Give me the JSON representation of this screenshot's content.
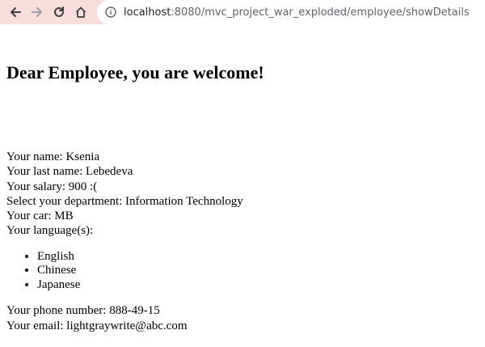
{
  "browser": {
    "url_host": "localhost",
    "url_rest": ":8080/mvc_project_war_exploded/employee/showDetails"
  },
  "page": {
    "heading": "Dear Employee, you are welcome!",
    "name_line": "Your name: Ksenia",
    "last_name_line": "Your last name: Lebedeva",
    "salary_line": "Your salary: 900 :(",
    "department_line": "Select your department: Information Technology",
    "car_line": "Your car: MB",
    "languages_label": "Your language(s):",
    "languages": [
      "English",
      "Chinese",
      "Japanese"
    ],
    "phone_line": "Your phone number: 888-49-15",
    "email_line": "Your email: lightgraywrite@abc.com"
  }
}
